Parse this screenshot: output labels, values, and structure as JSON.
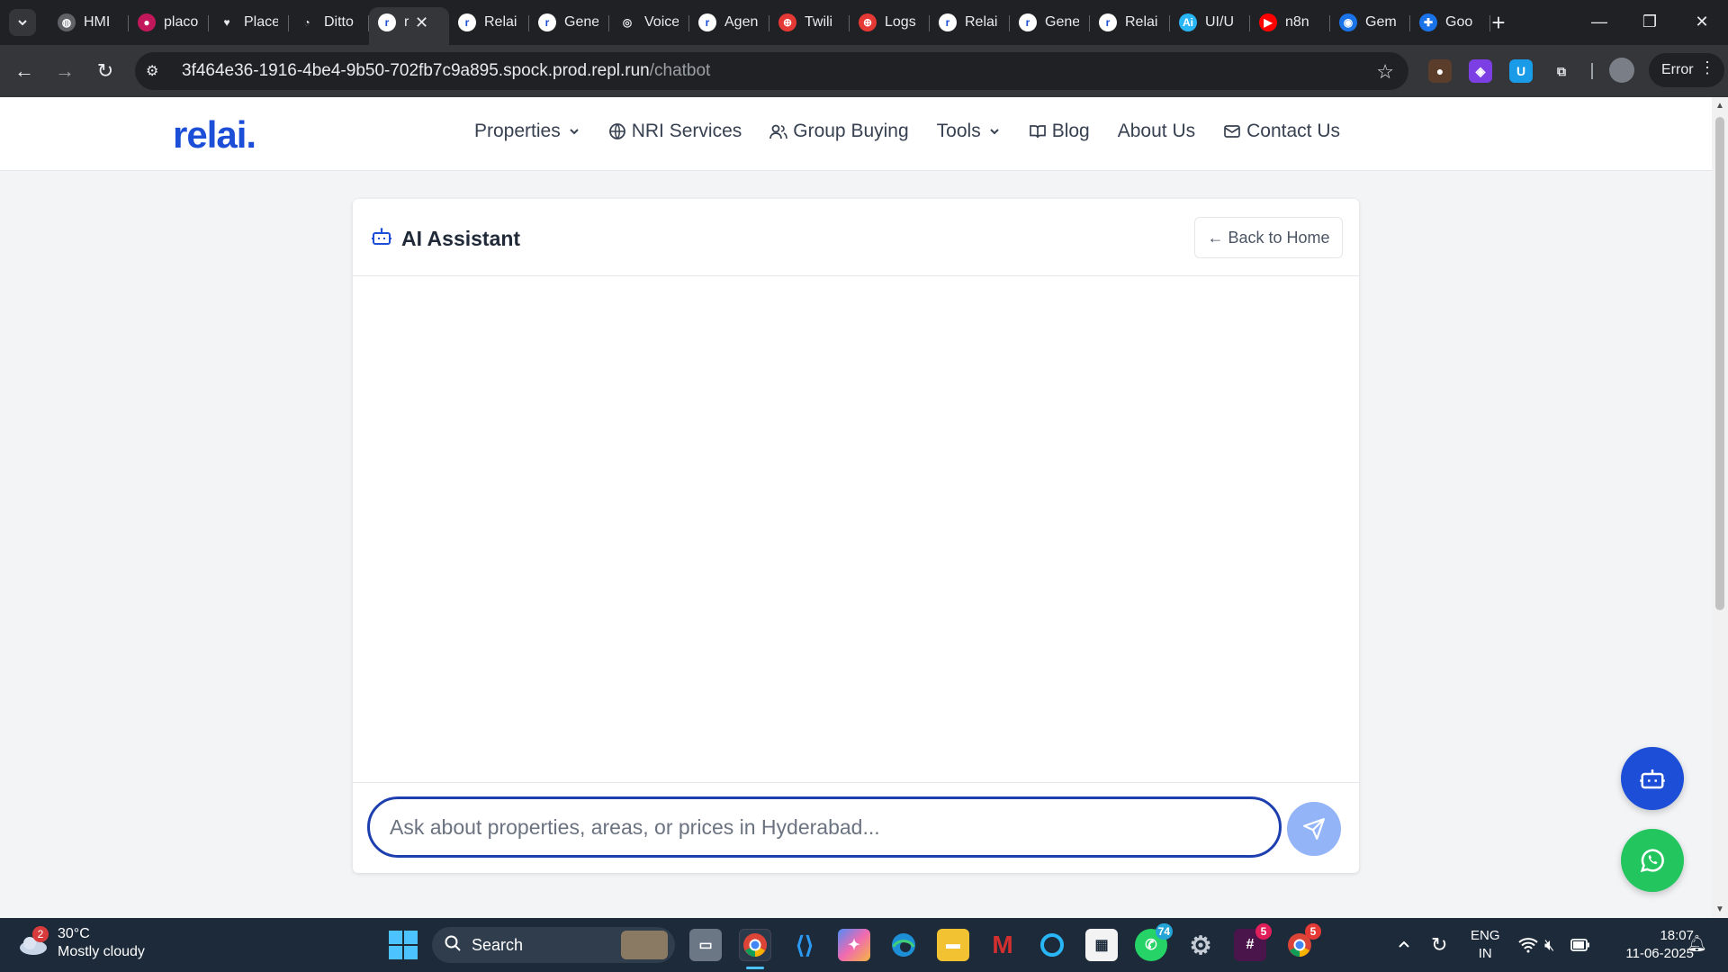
{
  "browser": {
    "tabs": [
      {
        "title": "HMI",
        "color": "#5f6368",
        "glyph": "◍"
      },
      {
        "title": "placo",
        "color": "#c2185b",
        "glyph": "●"
      },
      {
        "title": "Place",
        "color": "#202124",
        "glyph": "♥"
      },
      {
        "title": "Ditto",
        "color": "#202124",
        "glyph": "◔"
      },
      {
        "title": "r.",
        "color": "#ffffff",
        "glyph": "r",
        "active": true
      },
      {
        "title": "Relai",
        "color": "#ffffff",
        "glyph": "r"
      },
      {
        "title": "Gene",
        "color": "#ffffff",
        "glyph": "r"
      },
      {
        "title": "Voice",
        "color": "#202124",
        "glyph": "◎"
      },
      {
        "title": "Agen",
        "color": "#ffffff",
        "glyph": "r"
      },
      {
        "title": "Twili",
        "color": "#e53935",
        "glyph": "⊕"
      },
      {
        "title": "Logs",
        "color": "#e53935",
        "glyph": "⊕"
      },
      {
        "title": "Relai",
        "color": "#ffffff",
        "glyph": "r"
      },
      {
        "title": "Gene",
        "color": "#ffffff",
        "glyph": "r"
      },
      {
        "title": "Relai",
        "color": "#ffffff",
        "glyph": "r"
      },
      {
        "title": "UI/U",
        "color": "#29b6f6",
        "glyph": "Ai"
      },
      {
        "title": "n8n",
        "color": "#ff0000",
        "glyph": "▶"
      },
      {
        "title": "Gem",
        "color": "#1a73e8",
        "glyph": "◉"
      },
      {
        "title": "Goo",
        "color": "#1a73e8",
        "glyph": "✚"
      }
    ],
    "url_host": "3f464e36-1916-4be4-9b50-702fb7c9a895.spock.prod.repl.run",
    "url_path": "/chatbot",
    "error_label": "Error"
  },
  "site": {
    "logo": "relai.",
    "nav": {
      "properties": "Properties",
      "nri": "NRI Services",
      "group": "Group Buying",
      "tools": "Tools",
      "blog": "Blog",
      "about": "About Us",
      "contact": "Contact Us"
    }
  },
  "chat": {
    "title": "AI Assistant",
    "back_label": "← Back to Home",
    "input_placeholder": "Ask about properties, areas, or prices in Hyderabad...",
    "input_value": ""
  },
  "colors": {
    "brand": "#1d4ed8",
    "send_button": "#93b4f7",
    "whatsapp": "#22c55e"
  },
  "taskbar": {
    "weather_temp": "30°C",
    "weather_desc": "Mostly cloudy",
    "weather_badge": "2",
    "search_label": "Search",
    "whatsapp_badge": "74",
    "slack_badge": "5",
    "chrome_badge": "5",
    "lang_top": "ENG",
    "lang_bottom": "IN",
    "time": "18:07",
    "date": "11-06-2025"
  }
}
